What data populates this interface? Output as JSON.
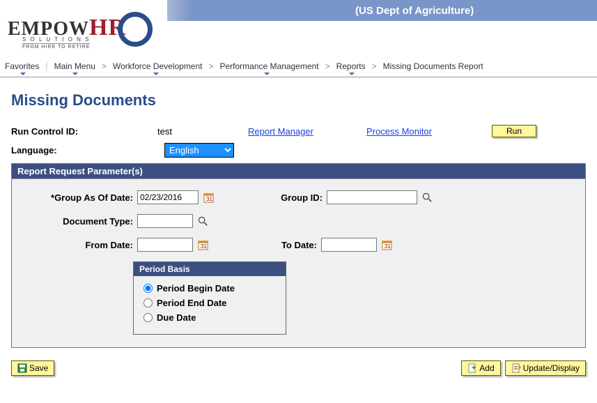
{
  "header": {
    "org_name": "(US Dept of Agriculture)",
    "logo": {
      "empow": "EMPOW",
      "hr": "HR",
      "sub1": "S O L U T I O N S",
      "sub2": "FROM HIRE TO RETIRE"
    }
  },
  "breadcrumb": {
    "favorites": "Favorites",
    "main_menu": "Main Menu",
    "items": [
      "Workforce Development",
      "Performance Management",
      "Reports",
      "Missing Documents Report"
    ]
  },
  "page": {
    "title": "Missing Documents",
    "run_control_label": "Run Control ID:",
    "run_control_value": "test",
    "language_label": "Language:",
    "language_value": "English",
    "report_manager": "Report Manager",
    "process_monitor": "Process Monitor",
    "run_button": "Run"
  },
  "section": {
    "title": "Report Request Parameter(s)",
    "group_asof_label": "*Group As Of Date:",
    "group_asof_value": "02/23/2016",
    "group_id_label": "Group ID:",
    "group_id_value": "",
    "doc_type_label": "Document Type:",
    "doc_type_value": "",
    "from_date_label": "From Date:",
    "from_date_value": "",
    "to_date_label": "To Date:",
    "to_date_value": "",
    "period_basis": {
      "title": "Period Basis",
      "options": [
        "Period Begin Date",
        "Period End Date",
        "Due Date"
      ],
      "selected": "Period Begin Date"
    }
  },
  "buttons": {
    "save": "Save",
    "add": "Add",
    "update_display": "Update/Display"
  }
}
